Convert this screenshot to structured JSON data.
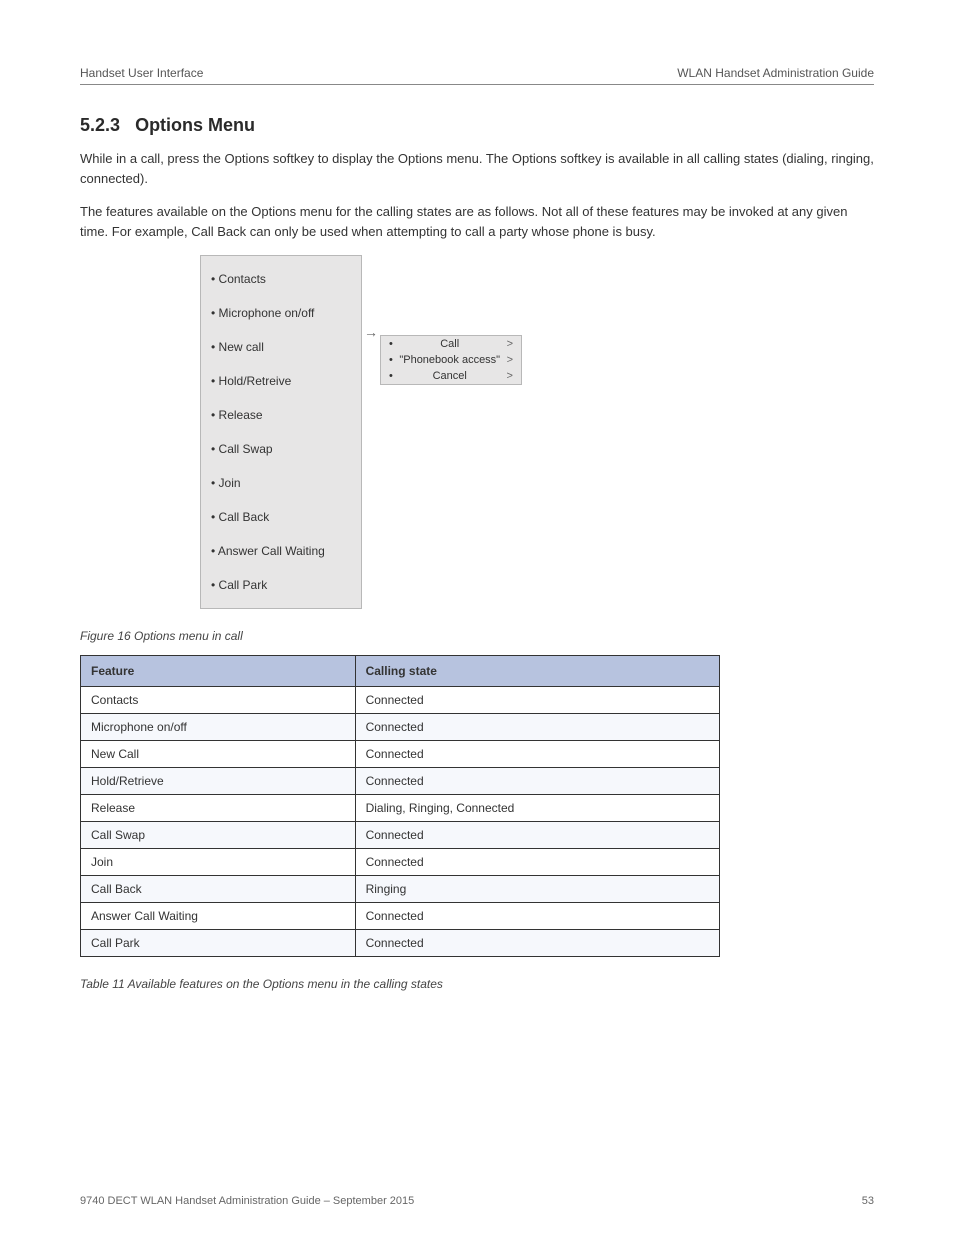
{
  "header": {
    "left": "Handset User Interface",
    "right": "WLAN Handset Administration Guide"
  },
  "section": {
    "number": "5.2.3",
    "title": "Options Menu",
    "para1": "While in a call, press the Options softkey to display the Options menu. The Options softkey is available in all calling states (dialing, ringing, connected).",
    "para2": "The features available on the Options menu for the calling states are as follows. Not all of these features may be invoked at any given time. For example, Call Back can only be used when attempting to call a party whose phone is busy."
  },
  "figure": {
    "main_menu": [
      "Contacts",
      "Microphone on/off",
      "New call",
      "Hold/Retreive",
      "Release",
      "Call Swap",
      "Join",
      "Call Back",
      "Answer Call Waiting",
      "Call Park"
    ],
    "sub_menu": [
      "Call",
      "\"Phonebook access\"",
      "Cancel"
    ],
    "caption": "Figure 16  Options menu in call"
  },
  "table": {
    "header": {
      "col1": "Feature",
      "col2": "Calling state"
    },
    "rows": [
      {
        "feature": "Contacts",
        "state": "Connected"
      },
      {
        "feature": "Microphone on/off",
        "state": "Connected"
      },
      {
        "feature": "New Call",
        "state": "Connected"
      },
      {
        "feature": "Hold/Retrieve",
        "state": "Connected"
      },
      {
        "feature": "Release",
        "state": "Dialing, Ringing, Connected"
      },
      {
        "feature": "Call Swap",
        "state": "Connected"
      },
      {
        "feature": "Join",
        "state": "Connected"
      },
      {
        "feature": "Call Back",
        "state": "Ringing"
      },
      {
        "feature": "Answer Call Waiting",
        "state": "Connected"
      },
      {
        "feature": "Call Park",
        "state": "Connected"
      }
    ],
    "caption": "Table 11  Available features on the Options menu in the calling states"
  },
  "footer": {
    "left": "9740 DECT WLAN Handset Administration Guide – September 2015",
    "right": "53"
  }
}
